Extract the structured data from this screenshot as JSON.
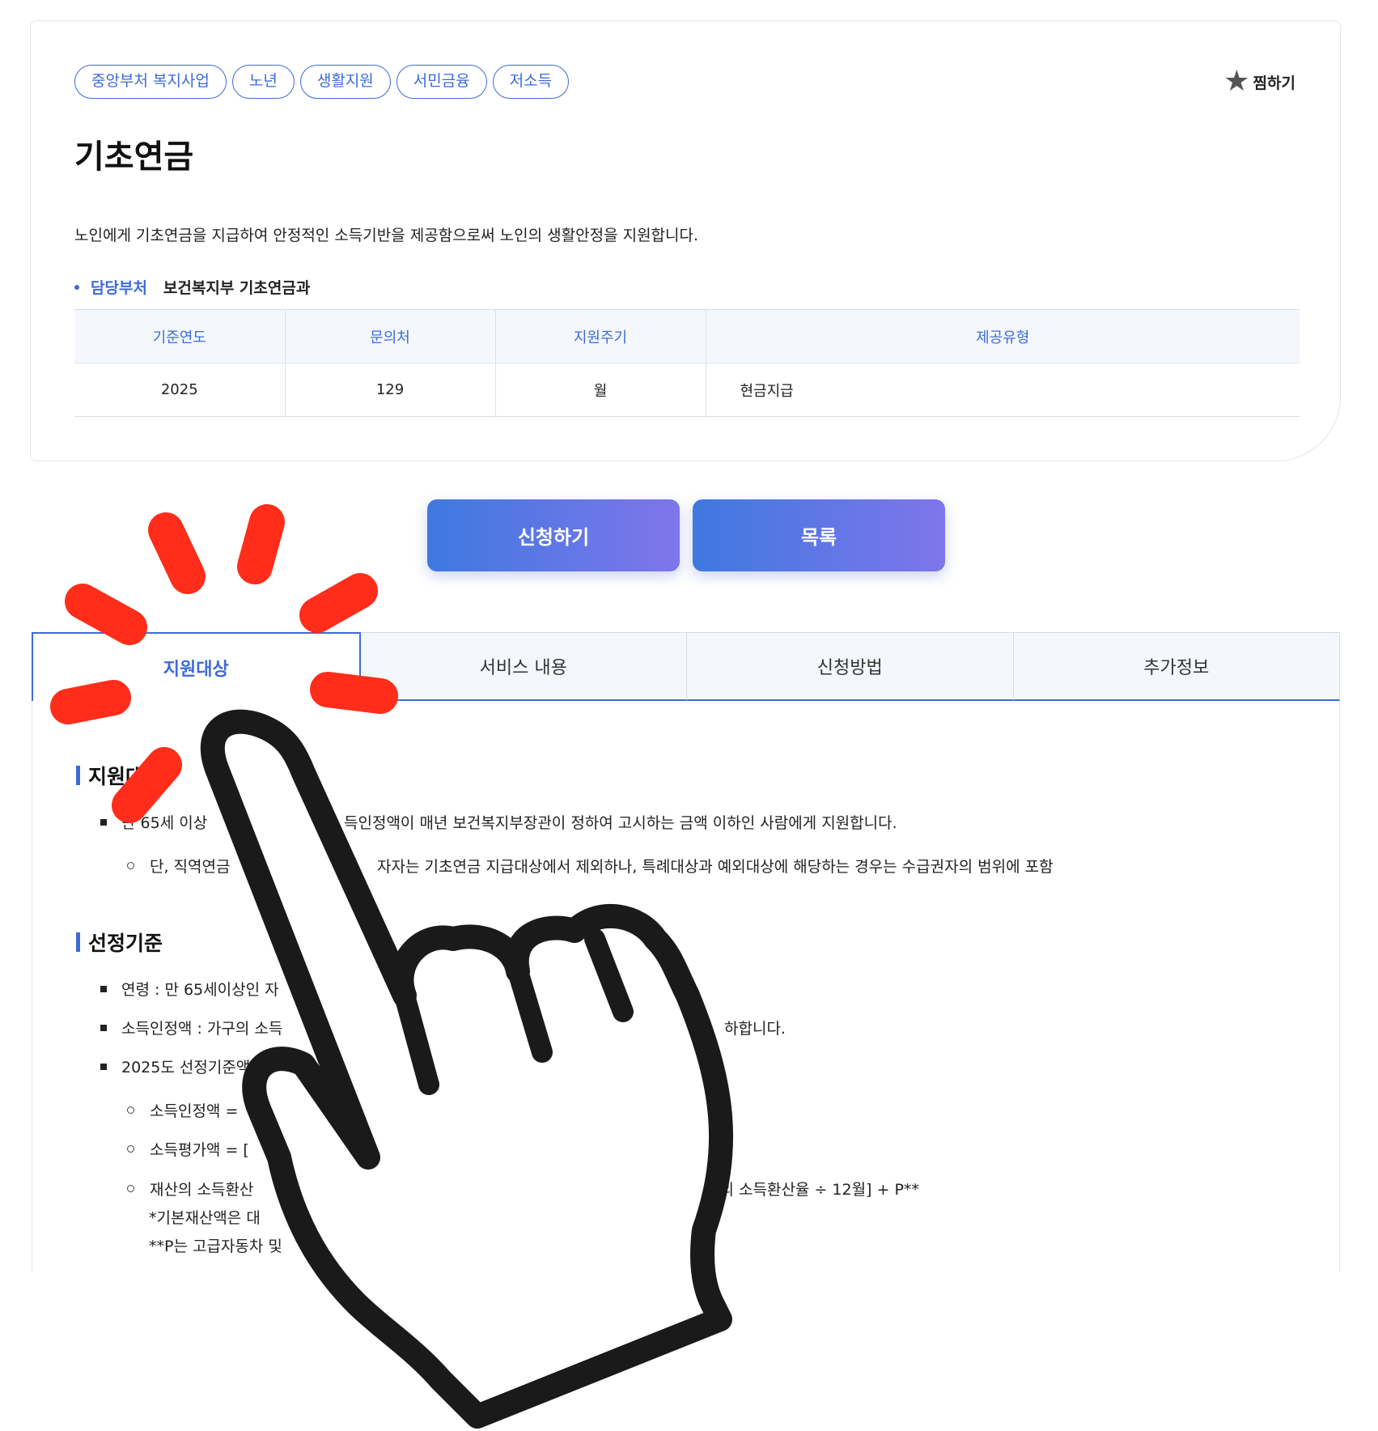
{
  "tags": [
    "중앙부처 복지사업",
    "노년",
    "생활지원",
    "서민금융",
    "저소득"
  ],
  "favorite_label": "찜하기",
  "title": "기초연금",
  "description": "노인에게 기초연금을 지급하여 안정적인 소득기반을 제공함으로써 노인의 생활안정을 지원합니다.",
  "department": {
    "label": "담당부처",
    "value": "보건복지부 기초연금과"
  },
  "info_table": {
    "headers": [
      "기준연도",
      "문의처",
      "지원주기",
      "제공유형"
    ],
    "values": [
      "2025",
      "129",
      "월",
      "현금지급"
    ]
  },
  "buttons": {
    "apply": "신청하기",
    "list": "목록"
  },
  "tabs": [
    {
      "label": "지원대상",
      "active": true
    },
    {
      "label": "서비스 내용",
      "active": false
    },
    {
      "label": "신청방법",
      "active": false
    },
    {
      "label": "추가정보",
      "active": false
    }
  ],
  "content": {
    "section1_title": "지원대",
    "section1_items": [
      "만 65세 이상",
      "득인정액이 매년 보건복지부장관이 정하여 고시하는 금액 이하인 사람에게 지원합니다."
    ],
    "section1_sub": [
      "단, 직역연금",
      "자자는 기초연금 지급대상에서 제외하나, 특례대상과 예외대상에 해당하는 경우는 수급권자의 범위에 포함"
    ],
    "section2_title": "선정기준",
    "section2_items": [
      "연령 : 만 65세이상인 자",
      "소득인정액 : 가구의 소득",
      "하합니다.",
      "2025도 선정기준액은 단독"
    ],
    "section2_sub": [
      "소득인정액 =",
      "소득평가액 = [",
      "재산의 소득환산",
      "산의 소득환산율 ÷ 12월] + P**"
    ],
    "section2_notes": [
      "*기본재산액은 대",
      "**P는 고급자동차 및"
    ]
  },
  "icons": {
    "favorite": "star-icon",
    "pointer": "pointing-hand-icon",
    "burst": "click-burst-icon"
  },
  "colors": {
    "accent": "#3d6bd8",
    "button_start": "#3f78e0",
    "button_end": "#7f76ea",
    "burst": "#ff2d1a"
  }
}
